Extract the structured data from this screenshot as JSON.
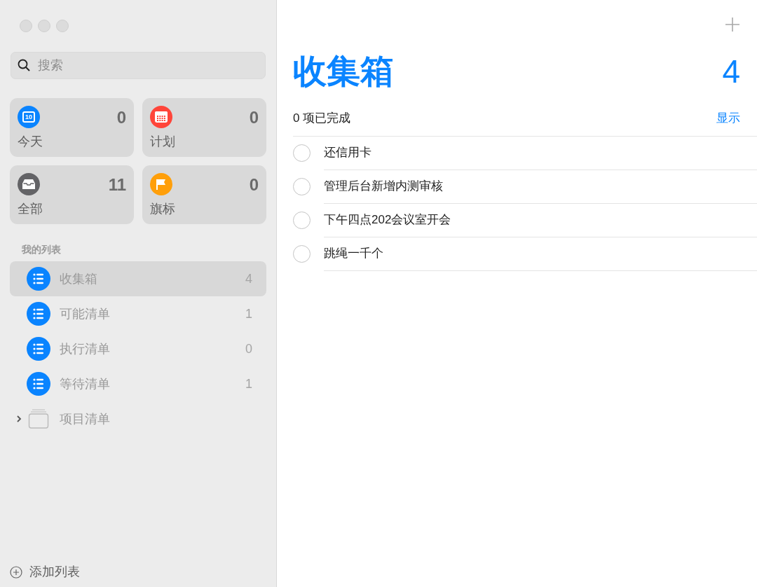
{
  "sidebar": {
    "search": {
      "placeholder": "搜索"
    },
    "smart_lists": [
      {
        "kind": "today",
        "label": "今天",
        "count": "0",
        "icon_text": "10",
        "color": "#0a84ff"
      },
      {
        "kind": "scheduled",
        "label": "计划",
        "count": "0",
        "color": "#ff453a"
      },
      {
        "kind": "all",
        "label": "全部",
        "count": "11",
        "color": "#636366"
      },
      {
        "kind": "flagged",
        "label": "旗标",
        "count": "0",
        "color": "#ff9f0a"
      }
    ],
    "section_title": "我的列表",
    "lists": [
      {
        "kind": "list",
        "label": "收集箱",
        "count": "4",
        "selected": true
      },
      {
        "kind": "list",
        "label": "可能清单",
        "count": "1",
        "selected": false
      },
      {
        "kind": "list",
        "label": "执行清单",
        "count": "0",
        "selected": false
      },
      {
        "kind": "list",
        "label": "等待清单",
        "count": "1",
        "selected": false
      },
      {
        "kind": "group",
        "label": "项目清单",
        "expanded": false,
        "selected": false
      }
    ],
    "add_list": "添加列表"
  },
  "main": {
    "title": "收集箱",
    "count": "4",
    "completed": "0 项已完成",
    "show_button": "显示",
    "tasks": [
      {
        "text": "还信用卡",
        "checked": false
      },
      {
        "text": "管理后台新增内测审核",
        "checked": false
      },
      {
        "text": "下午四点202会议室开会",
        "checked": false
      },
      {
        "text": "跳绳一千个",
        "checked": false
      }
    ]
  }
}
